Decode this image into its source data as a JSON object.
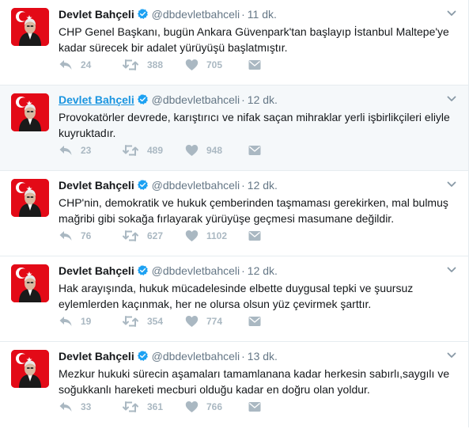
{
  "tweets": [
    {
      "name": "Devlet Bahçeli",
      "handle": "@dbdevletbahceli",
      "separator": "·",
      "time": "11 dk.",
      "text": "CHP Genel Başkanı, bugün Ankara Güvenpark'tan başlayıp İstanbul Maltepe'ye kadar sürecek bir adalet yürüyüşü başlatmıştır.",
      "replies": "24",
      "retweets": "388",
      "likes": "705",
      "hovered": false
    },
    {
      "name": "Devlet Bahçeli",
      "handle": "@dbdevletbahceli",
      "separator": "·",
      "time": "12 dk.",
      "text": "Provokatörler devrede, karıştırıcı ve nifak saçan mihraklar yerli işbirlikçileri eliyle kuyruktadır.",
      "replies": "23",
      "retweets": "489",
      "likes": "948",
      "hovered": true
    },
    {
      "name": "Devlet Bahçeli",
      "handle": "@dbdevletbahceli",
      "separator": "·",
      "time": "12 dk.",
      "text": "CHP'nin, demokratik ve hukuk çemberinden taşmaması gerekirken, mal bulmuş mağribi gibi sokağa fırlayarak yürüyüşe geçmesi masumane değildir.",
      "replies": "76",
      "retweets": "627",
      "likes": "1102",
      "hovered": false
    },
    {
      "name": "Devlet Bahçeli",
      "handle": "@dbdevletbahceli",
      "separator": "·",
      "time": "12 dk.",
      "text": "Hak arayışında, hukuk mücadelesinde elbette duygusal tepki ve şuursuz eylemlerden kaçınmak, her ne olursa olsun yüz çevirmek şarttır.",
      "replies": "19",
      "retweets": "354",
      "likes": "774",
      "hovered": false
    },
    {
      "name": "Devlet Bahçeli",
      "handle": "@dbdevletbahceli",
      "separator": "·",
      "time": "13 dk.",
      "text": "Mezkur hukuki sürecin aşamaları tamamlanana kadar herkesin sabırlı,saygılı ve soğukkanlı hareketi mecburi olduğu kadar en doğru olan yoldur.",
      "replies": "33",
      "retweets": "361",
      "likes": "766",
      "hovered": false
    }
  ],
  "colors": {
    "verified": "#1da1f2",
    "action_icon": "#aab8c2",
    "hover_bg": "#f5f8fa",
    "avatar_flag": "#e30a17"
  },
  "icons": {
    "verified": "verified-badge-icon",
    "caret": "chevron-down-icon",
    "reply": "reply-icon",
    "retweet": "retweet-icon",
    "like": "heart-icon",
    "dm": "envelope-icon"
  }
}
